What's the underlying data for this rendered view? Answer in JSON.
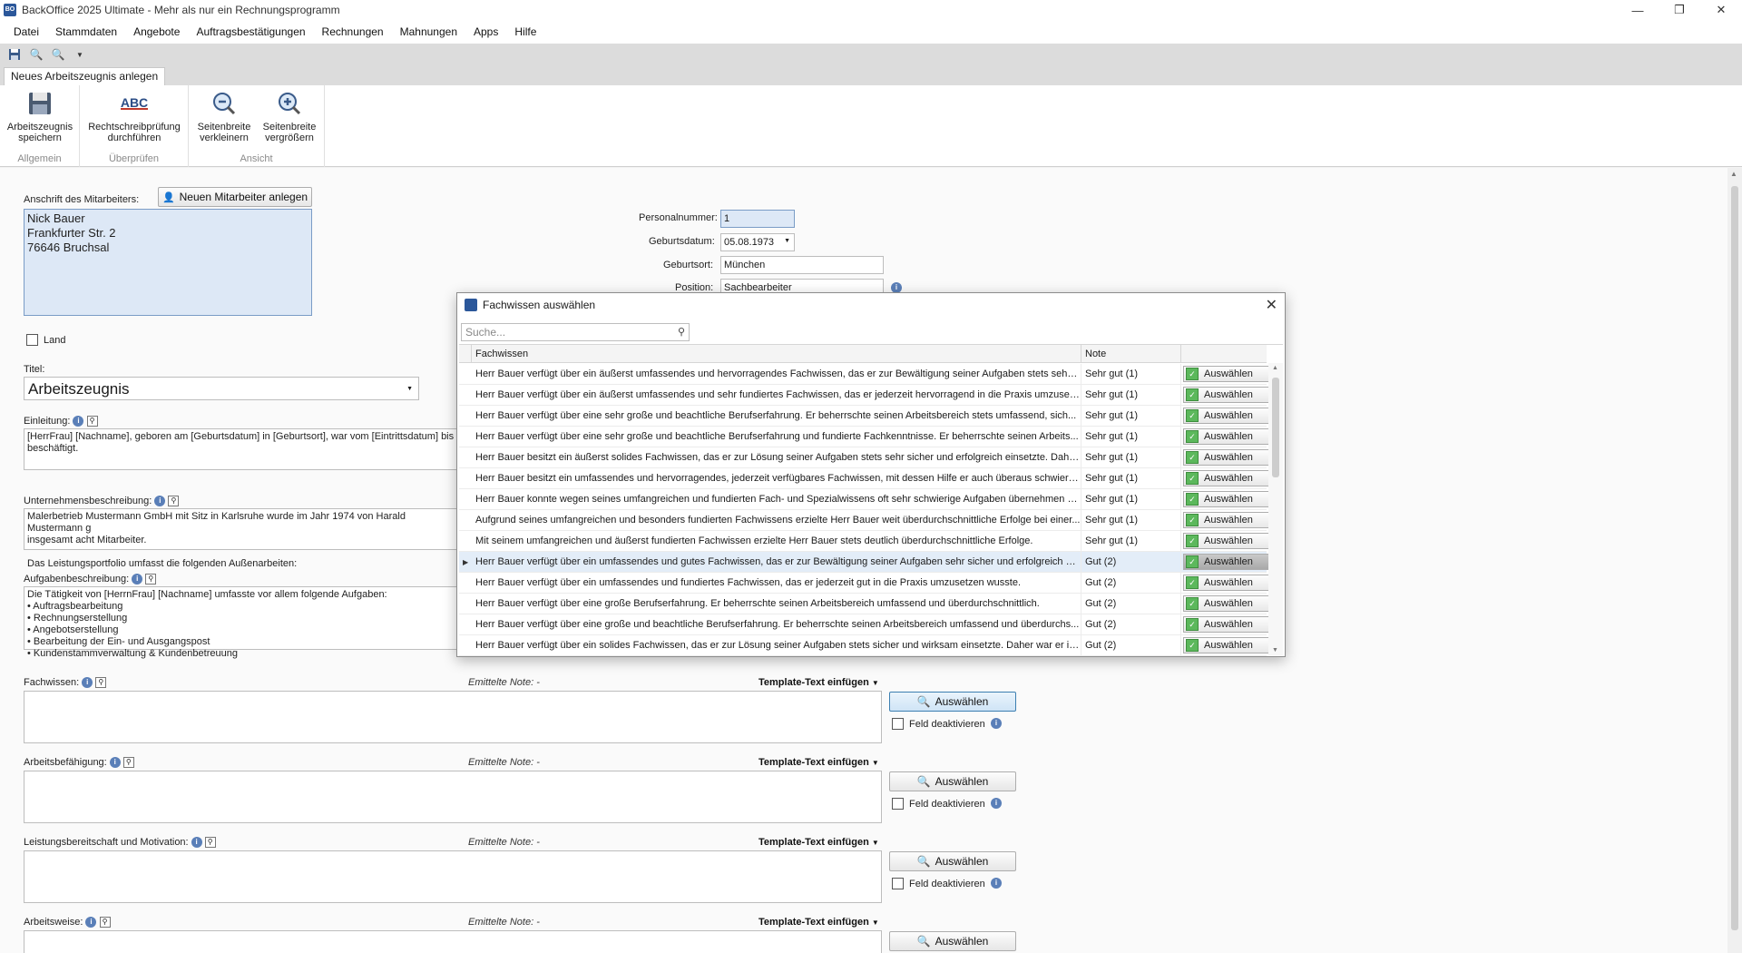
{
  "window": {
    "title": "BackOffice 2025 Ultimate - Mehr als nur ein Rechnungsprogramm",
    "app_icon": "BO"
  },
  "menu": [
    "Datei",
    "Stammdaten",
    "Angebote",
    "Auftragsbestätigungen",
    "Rechnungen",
    "Mahnungen",
    "Apps",
    "Hilfe"
  ],
  "ribbon": {
    "tab": "Neues Arbeitszeugnis anlegen",
    "groups": {
      "allgemein": "Allgemein",
      "ueberpruefen": "Überprüfen",
      "ansicht": "Ansicht"
    },
    "buttons": {
      "save": "Arbeitszeugnis\nspeichern",
      "spell": "Rechtschreibprüfung\ndurchführen",
      "spell_icon_text": "ABC",
      "zoom_out": "Seitenbreite\nverkleinern",
      "zoom_in": "Seitenbreite\nvergrößern"
    }
  },
  "form": {
    "address_label": "Anschrift des Mitarbeiters:",
    "new_employee_button": "Neuen Mitarbeiter anlegen",
    "address_value": "Nick Bauer\nFrankfurter Str. 2\n76646 Bruchsal",
    "land_label": "Land",
    "personalnummer_label": "Personalnummer:",
    "personalnummer_value": "1",
    "geburtsdatum_label": "Geburtsdatum:",
    "geburtsdatum_value": "05.08.1973",
    "geburtsort_label": "Geburtsort:",
    "geburtsort_value": "München",
    "position_label": "Position:",
    "position_value": "Sachbearbeiter",
    "titel_label": "Titel:",
    "titel_value": "Arbeitszeugnis",
    "einleitung_label": "Einleitung:",
    "einleitung_value": "[HerrFrau] [Nachname], geboren am [Geburtsdatum] in [Geburtsort], war vom [Eintrittsdatum] bis\nbeschäftigt.",
    "unternehmen_label": "Unternehmensbeschreibung:",
    "unternehmen_value": "Malerbetrieb Mustermann GmbH mit Sitz in Karlsruhe wurde im Jahr 1974 von Harald Mustermann g\ninsgesamt acht Mitarbeiter.\n\nDas Leistungsportfolio umfasst die folgenden Außenarbeiten:",
    "aufgaben_label": "Aufgabenbeschreibung:",
    "aufgaben_value": "Die Tätigkeit von [HerrnFrau] [Nachname] umfasste vor allem folgende Aufgaben:\n• Auftragsbearbeitung\n• Rechnungserstellung\n• Angebotserstellung\n• Bearbeitung der Ein- und Ausgangspost\n• Kundenstammverwaltung & Kundenbetreuung",
    "sections": [
      {
        "label": "Fachwissen:",
        "note": "Emittelte Note: -",
        "template": "Template-Text einfügen",
        "button": "Auswählen",
        "deactivate": "Feld deaktivieren"
      },
      {
        "label": "Arbeitsbefähigung:",
        "note": "Emittelte Note: -",
        "template": "Template-Text einfügen",
        "button": "Auswählen",
        "deactivate": "Feld deaktivieren"
      },
      {
        "label": "Leistungsbereitschaft und Motivation:",
        "note": "Emittelte Note: -",
        "template": "Template-Text einfügen",
        "button": "Auswählen",
        "deactivate": "Feld deaktivieren"
      },
      {
        "label": "Arbeitsweise:",
        "note": "Emittelte Note: -",
        "template": "Template-Text einfügen",
        "button": "Auswählen"
      }
    ]
  },
  "dialog": {
    "title": "Fachwissen auswählen",
    "search_placeholder": "Suche...",
    "columns": {
      "text": "Fachwissen",
      "grade": "Note"
    },
    "select_label": "Auswählen",
    "selected_row": 9,
    "rows": [
      {
        "text": "Herr Bauer verfügt über ein äußerst umfassendes und hervorragendes Fachwissen, das er zur Bewältigung seiner Aufgaben stets sehr ...",
        "grade": "Sehr gut (1)"
      },
      {
        "text": "Herr Bauer verfügt über ein äußerst umfassendes und sehr fundiertes Fachwissen, das er jederzeit hervorragend in die Praxis umzuset...",
        "grade": "Sehr gut (1)"
      },
      {
        "text": "Herr Bauer verfügt über eine sehr große und beachtliche Berufserfahrung. Er beherrschte seinen Arbeitsbereich stets umfassend, sich...",
        "grade": "Sehr gut (1)"
      },
      {
        "text": "Herr Bauer verfügt über eine sehr große und beachtliche Berufserfahrung und fundierte Fachkenntnisse. Er beherrschte seinen Arbeits...",
        "grade": "Sehr gut (1)"
      },
      {
        "text": "Herr Bauer besitzt ein äußerst solides Fachwissen, das er zur Lösung seiner Aufgaben stets sehr sicher und erfolgreich einsetzte. Dahe...",
        "grade": "Sehr gut (1)"
      },
      {
        "text": "Herr Bauer besitzt ein umfassendes und hervorragendes, jederzeit verfügbares Fachwissen, mit dessen Hilfe er auch überaus schwierig...",
        "grade": "Sehr gut (1)"
      },
      {
        "text": "Herr Bauer konnte wegen seines umfangreichen und fundierten Fach- und Spezialwissens oft sehr schwierige Aufgaben übernehmen un...",
        "grade": "Sehr gut (1)"
      },
      {
        "text": "Aufgrund seines umfangreichen und besonders fundierten Fachwissens erzielte Herr Bauer weit überdurchschnittliche Erfolge bei einer...",
        "grade": "Sehr gut (1)"
      },
      {
        "text": "Mit seinem umfangreichen und äußerst fundierten Fachwissen erzielte Herr Bauer stets deutlich überdurchschnittliche Erfolge.",
        "grade": "Sehr gut (1)"
      },
      {
        "text": "Herr Bauer verfügt über ein umfassendes und gutes Fachwissen, das er zur Bewältigung seiner Aufgaben sehr sicher und erfolgreich ei...",
        "grade": "Gut (2)"
      },
      {
        "text": "Herr Bauer verfügt über ein umfassendes und fundiertes Fachwissen, das er jederzeit gut in die Praxis umzusetzen wusste.",
        "grade": "Gut (2)"
      },
      {
        "text": "Herr Bauer verfügt über eine große Berufserfahrung. Er beherrschte seinen Arbeitsbereich umfassend und überdurchschnittlich.",
        "grade": "Gut (2)"
      },
      {
        "text": "Herr Bauer verfügt über eine große und beachtliche Berufserfahrung. Er beherrschte seinen Arbeitsbereich umfassend und überdurchs...",
        "grade": "Gut (2)"
      },
      {
        "text": "Herr Bauer verfügt über ein solides Fachwissen, das er zur Lösung seiner Aufgaben stets sicher und wirksam einsetzte. Daher war er in...",
        "grade": "Gut (2)"
      }
    ]
  }
}
